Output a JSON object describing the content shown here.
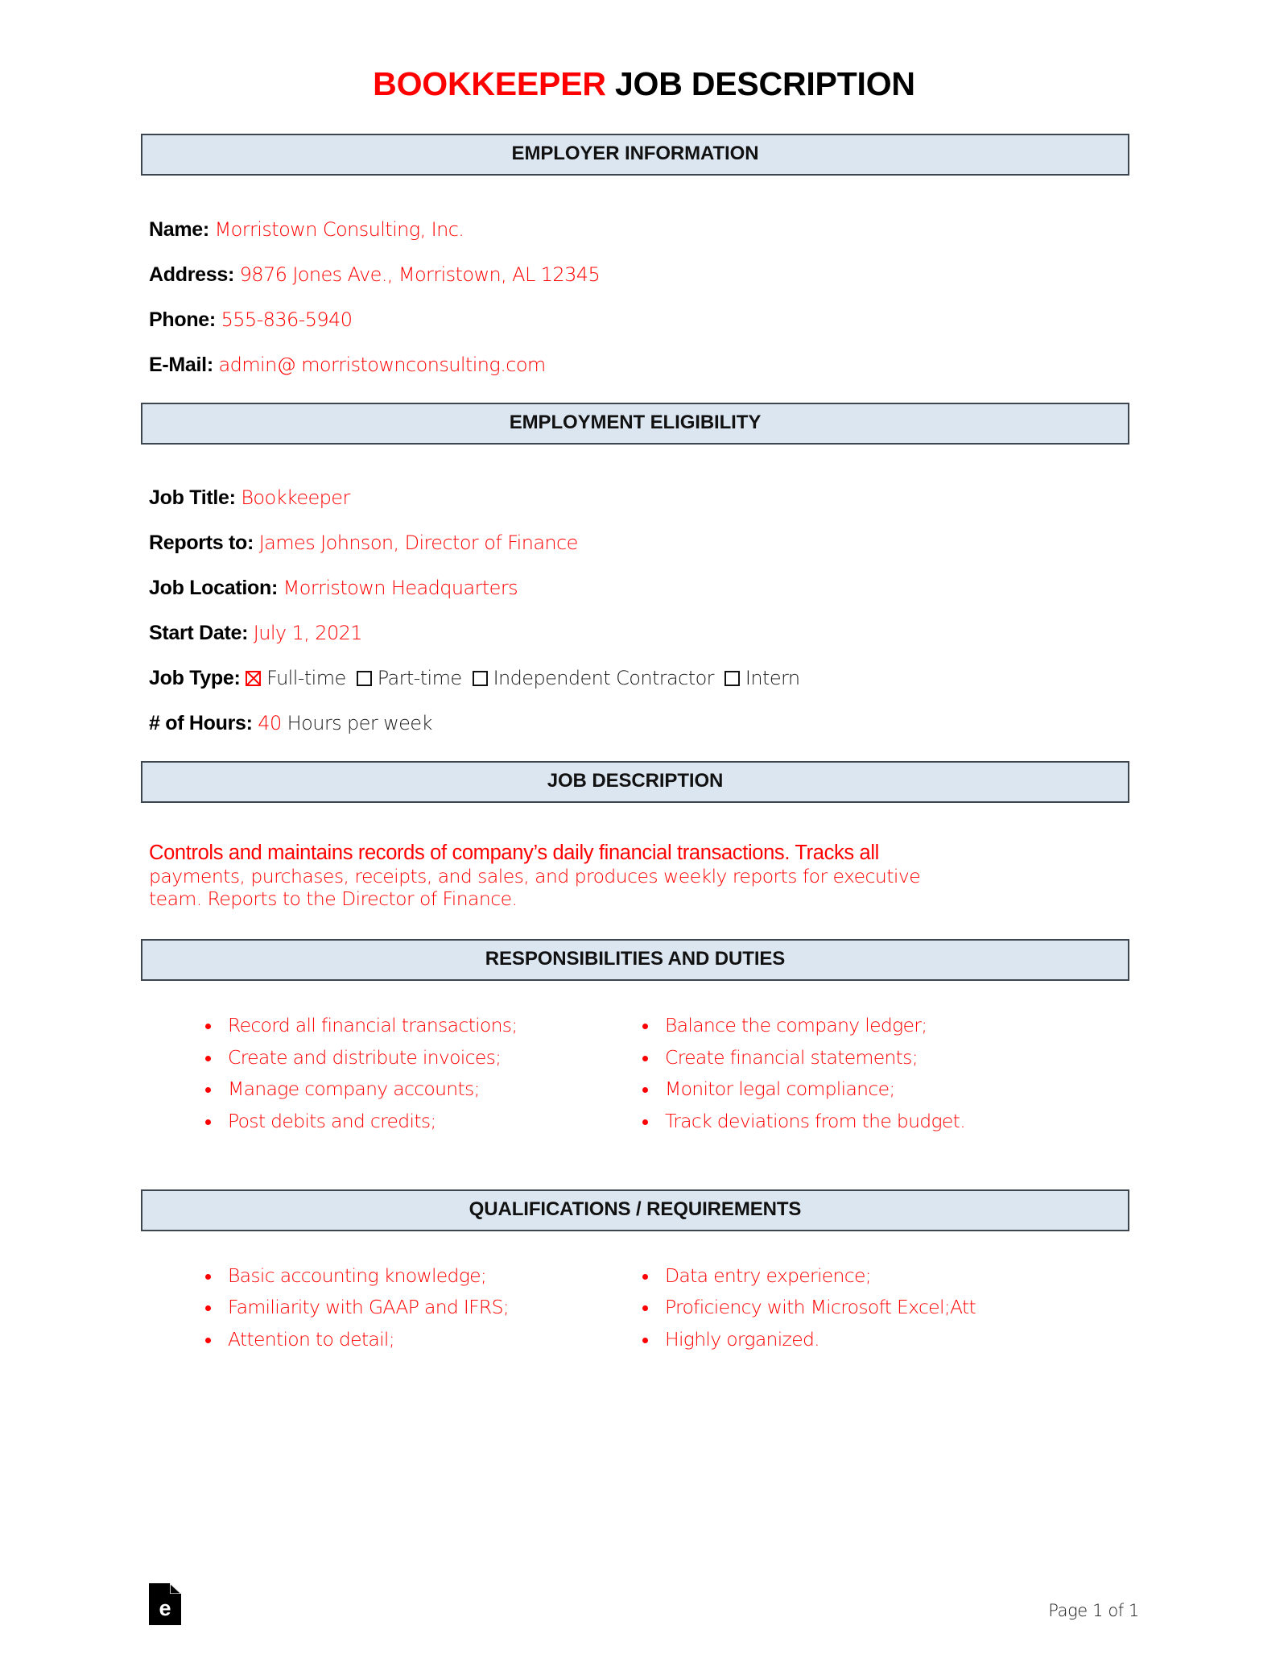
{
  "title": {
    "accent": "BOOKKEEPER",
    "rest": " JOB DESCRIPTION"
  },
  "sections": {
    "employer": "EMPLOYER INFORMATION",
    "eligibility": "EMPLOYMENT ELIGIBILITY",
    "job_description": "JOB DESCRIPTION",
    "responsibilities": "RESPONSIBILITIES AND DUTIES",
    "qualifications": "QUALIFICATIONS / REQUIREMENTS"
  },
  "employer": {
    "name_label": "Name",
    "name_value": "Morristown Consulting, Inc.",
    "address_label": "Address",
    "address_value": "9876 Jones Ave., Morristown, AL 12345",
    "phone_label": "Phone",
    "phone_value": "555-836-5940",
    "email_label": "E-Mail",
    "email_value": "admin@ morristownconsulting.com"
  },
  "eligibility": {
    "job_title_label": "Job Title",
    "job_title_value": "Bookkeeper",
    "reports_to_label": "Reports to",
    "reports_to_value": "James Johnson, Director of Finance",
    "job_location_label": "Job Location",
    "job_location_value": "Morristown Headquarters",
    "start_date_label": "Start Date",
    "start_date_value": "July 1, 2021",
    "job_type_label": "Job Type",
    "job_type_options": [
      {
        "label": "Full-time",
        "checked": true
      },
      {
        "label": "Part-time",
        "checked": false
      },
      {
        "label": "Independent Contractor",
        "checked": false
      },
      {
        "label": "Intern",
        "checked": false
      }
    ],
    "hours_label": "# of Hours",
    "hours_value": "40",
    "hours_suffix": "Hours per week"
  },
  "job_description": {
    "line1": "Controls and maintains records of company’s daily financial transactions. Tracks all",
    "line2": "payments, purchases, receipts, and sales, and produces weekly reports for executive",
    "line3": "team. Reports to the Director of Finance."
  },
  "responsibilities": {
    "left": [
      "Record all financial transactions;",
      "Create and distribute invoices;",
      "Manage company accounts;",
      "Post debits and credits;"
    ],
    "right": [
      "Balance the company ledger;",
      "Create financial statements;",
      "Monitor legal compliance;",
      "Track deviations from the budget."
    ]
  },
  "qualifications": {
    "left": [
      "Basic accounting knowledge;",
      "Familiarity with GAAP and IFRS;",
      "Attention to detail;"
    ],
    "right": [
      "Data entry experience;",
      "Proficiency with Microsoft Excel;Att",
      "Highly organized."
    ]
  },
  "footer": {
    "page_number": "Page 1 of 1",
    "logo_letter": "e"
  },
  "colors": {
    "accent_red": "#ff0000",
    "bar_fill": "#dce6f1",
    "bar_border": "#3d464f",
    "text_black": "#000000"
  }
}
